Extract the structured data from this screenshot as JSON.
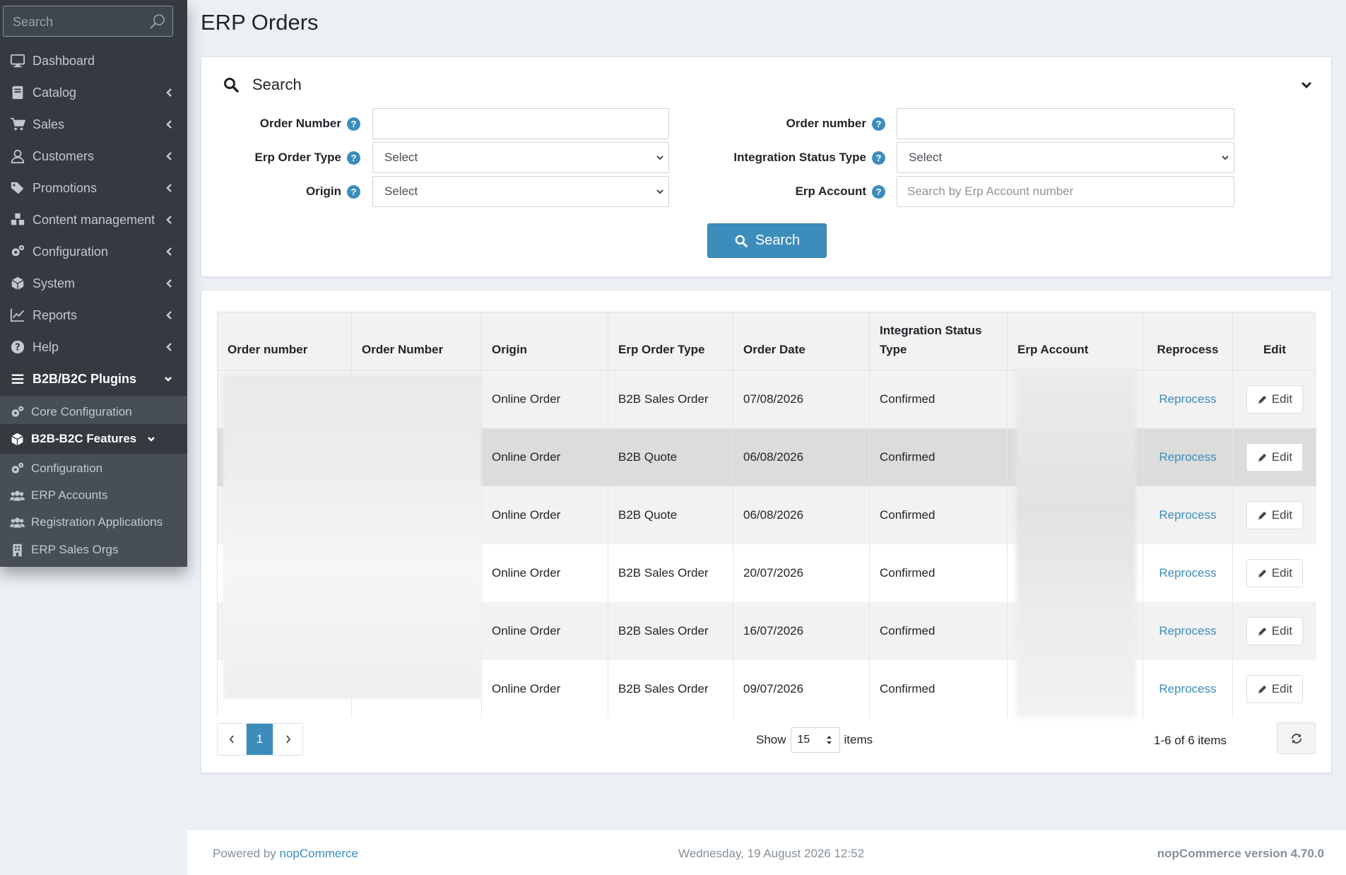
{
  "sidebar": {
    "search_placeholder": "Search",
    "items": [
      {
        "label": "Dashboard",
        "icon": "monitor-icon"
      },
      {
        "label": "Catalog",
        "icon": "book-icon"
      },
      {
        "label": "Sales",
        "icon": "cart-icon"
      },
      {
        "label": "Customers",
        "icon": "user-icon"
      },
      {
        "label": "Promotions",
        "icon": "tags-icon"
      },
      {
        "label": "Content management",
        "icon": "cubes-icon"
      },
      {
        "label": "Configuration",
        "icon": "gears-icon"
      },
      {
        "label": "System",
        "icon": "cube-icon"
      },
      {
        "label": "Reports",
        "icon": "line-chart-icon"
      },
      {
        "label": "Help",
        "icon": "question-circle-icon"
      },
      {
        "label": "B2B/B2C Plugins",
        "icon": "bars-icon"
      }
    ],
    "sub_items": [
      {
        "label": "Core Configuration",
        "icon": "gears-icon"
      },
      {
        "label": "B2B-B2C Features",
        "icon": "cube-icon"
      },
      {
        "label": "Configuration",
        "icon": "gears-icon"
      },
      {
        "label": "ERP Accounts",
        "icon": "users-icon"
      },
      {
        "label": "Registration Applications",
        "icon": "users-icon"
      },
      {
        "label": "ERP Sales Orgs",
        "icon": "building-icon"
      }
    ]
  },
  "page": {
    "title": "ERP Orders"
  },
  "search_panel": {
    "title": "Search",
    "fields": {
      "order_number_left": {
        "label": "Order Number",
        "value": ""
      },
      "erp_order_type": {
        "label": "Erp Order Type",
        "value": "Select"
      },
      "origin": {
        "label": "Origin",
        "value": "Select"
      },
      "order_number_right": {
        "label": "Order number",
        "value": ""
      },
      "integration_status_type": {
        "label": "Integration Status Type",
        "value": "Select"
      },
      "erp_account": {
        "label": "Erp Account",
        "placeholder": "Search by Erp Account number"
      }
    },
    "search_button": "Search"
  },
  "table": {
    "headers": {
      "c0": "Order number",
      "c1": "Order Number",
      "c2": "Origin",
      "c3": "Erp Order Type",
      "c4": "Order Date",
      "c5": "Integration Status Type",
      "c6": "Erp Account",
      "c7": "Reprocess",
      "c8": "Edit"
    },
    "rows": [
      {
        "origin": "Online Order",
        "type": "B2B Sales Order",
        "date": "07/08/2026",
        "status": "Confirmed",
        "reprocess": "Reprocess",
        "edit": "Edit"
      },
      {
        "origin": "Online Order",
        "type": "B2B Quote",
        "date": "06/08/2026",
        "status": "Confirmed",
        "reprocess": "Reprocess",
        "edit": "Edit"
      },
      {
        "origin": "Online Order",
        "type": "B2B Quote",
        "date": "06/08/2026",
        "status": "Confirmed",
        "reprocess": "Reprocess",
        "edit": "Edit"
      },
      {
        "origin": "Online Order",
        "type": "B2B Sales Order",
        "date": "20/07/2026",
        "status": "Confirmed",
        "reprocess": "Reprocess",
        "edit": "Edit"
      },
      {
        "origin": "Online Order",
        "type": "B2B Sales Order",
        "date": "16/07/2026",
        "status": "Confirmed",
        "reprocess": "Reprocess",
        "edit": "Edit"
      },
      {
        "origin": "Online Order",
        "type": "B2B Sales Order",
        "date": "09/07/2026",
        "status": "Confirmed",
        "reprocess": "Reprocess",
        "edit": "Edit"
      }
    ]
  },
  "pagination": {
    "current_page": "1",
    "show_label": "Show",
    "page_size": "15",
    "items_label": "items",
    "info": "1-6 of 6 items"
  },
  "footer": {
    "powered_by": "Powered by",
    "brand": "nopCommerce",
    "datetime": "Wednesday, 19 August 2026 12:52",
    "version": "nopCommerce version 4.70.0"
  },
  "colors": {
    "accent": "#3c8dbc",
    "sidebar_bg": "#343a40",
    "subnav_bg": "#474e55"
  }
}
